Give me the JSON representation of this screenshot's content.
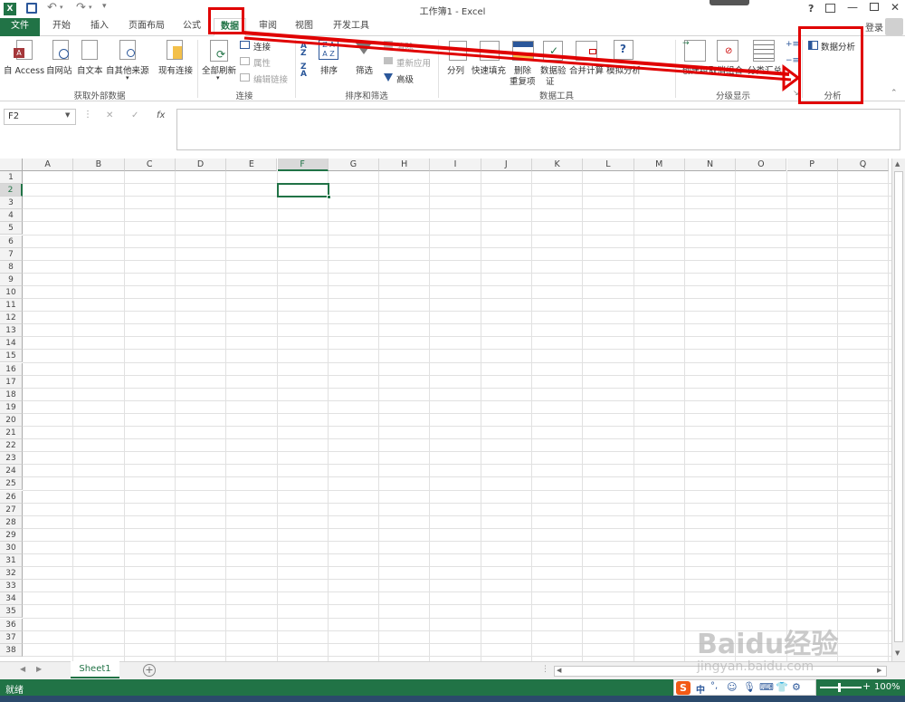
{
  "window": {
    "title": "工作簿1 - Excel",
    "help": "?",
    "login": "登录"
  },
  "tabs": [
    "文件",
    "开始",
    "插入",
    "页面布局",
    "公式",
    "数据",
    "审阅",
    "视图",
    "开发工具"
  ],
  "ribbon": {
    "get_external": {
      "buttons": [
        "自 Access",
        "自网站",
        "自文本",
        "自其他来源",
        "现有连接"
      ],
      "label": "获取外部数据"
    },
    "connections": {
      "refresh_all": "全部刷新",
      "connections": "连接",
      "properties": "属性",
      "edit_links": "编辑链接",
      "label": "连接"
    },
    "sort_filter": {
      "sort": "排序",
      "filter": "筛选",
      "clear": "清除",
      "reapply": "重新应用",
      "advanced": "高级",
      "label": "排序和筛选"
    },
    "data_tools": {
      "text_to_columns": "分列",
      "flash_fill": "快速填充",
      "remove_dup_1": "删除",
      "remove_dup_2": "重复项",
      "validation_1": "数据验",
      "validation_2": "证",
      "consolidate": "合并计算",
      "whatif": "模拟分析",
      "label": "数据工具"
    },
    "outline": {
      "group": "创建组",
      "ungroup": "取消组合",
      "subtotal": "分类汇总",
      "label": "分级显示"
    },
    "analysis": {
      "data_analysis": "数据分析",
      "label": "分析"
    }
  },
  "formula_bar": {
    "name_box": "F2",
    "cancel": "✕",
    "enter": "✓",
    "fx": "fx",
    "value": ""
  },
  "grid": {
    "columns": [
      "A",
      "B",
      "C",
      "D",
      "E",
      "F",
      "G",
      "H",
      "I",
      "J",
      "K",
      "L",
      "M",
      "N",
      "O",
      "P",
      "Q"
    ],
    "rows": [
      "1",
      "2",
      "3",
      "4",
      "5",
      "6",
      "7",
      "8",
      "9",
      "10",
      "11",
      "12",
      "13",
      "14",
      "15",
      "16",
      "17",
      "18",
      "19",
      "20",
      "21",
      "22",
      "23",
      "24",
      "25",
      "26",
      "27",
      "28",
      "29",
      "30",
      "31",
      "32",
      "33",
      "34",
      "35",
      "36",
      "37",
      "38"
    ],
    "selected_cell": "F2"
  },
  "sheets": {
    "active": "Sheet1",
    "add": "+"
  },
  "status": {
    "ready": "就绪",
    "zoom": "100%",
    "ime": "中"
  },
  "watermark": {
    "brand": "Baidu经验",
    "url": "jingyan.baidu.com"
  },
  "colors": {
    "excel_green": "#217346",
    "annotation_red": "#e00000"
  }
}
